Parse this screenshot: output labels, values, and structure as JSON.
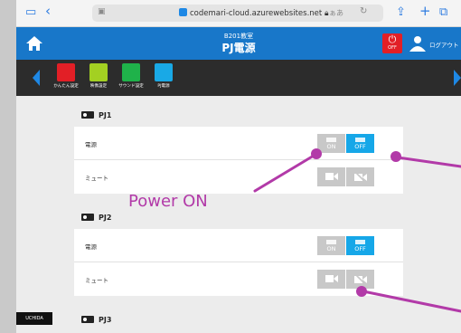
{
  "browser": {
    "url": "codemari-cloud.azurewebsites.net",
    "text_size": "ぁあ"
  },
  "header": {
    "room": "B201教室",
    "page_title": "PJ電源",
    "all_off_label": "OFF",
    "logout_label": "ログアウト"
  },
  "nav": {
    "items": [
      {
        "label": "かんたん設定",
        "color": "#e21f26"
      },
      {
        "label": "映像設定",
        "color": "#a3d022"
      },
      {
        "label": "サウンド設定",
        "color": "#1fb24a"
      },
      {
        "label": "PJ電源",
        "color": "#19a9e6"
      }
    ]
  },
  "projectors": [
    {
      "name": "PJ1",
      "power_label": "電源",
      "on_label": "ON",
      "off_label": "OFF",
      "mute_label": "ミュート"
    },
    {
      "name": "PJ2",
      "power_label": "電源",
      "on_label": "ON",
      "off_label": "OFF",
      "mute_label": "ミュート"
    },
    {
      "name": "PJ3"
    }
  ],
  "brand": "UCHIDA",
  "annotation": {
    "power_on_text": "Power ON",
    "color": "#b23aa8"
  }
}
